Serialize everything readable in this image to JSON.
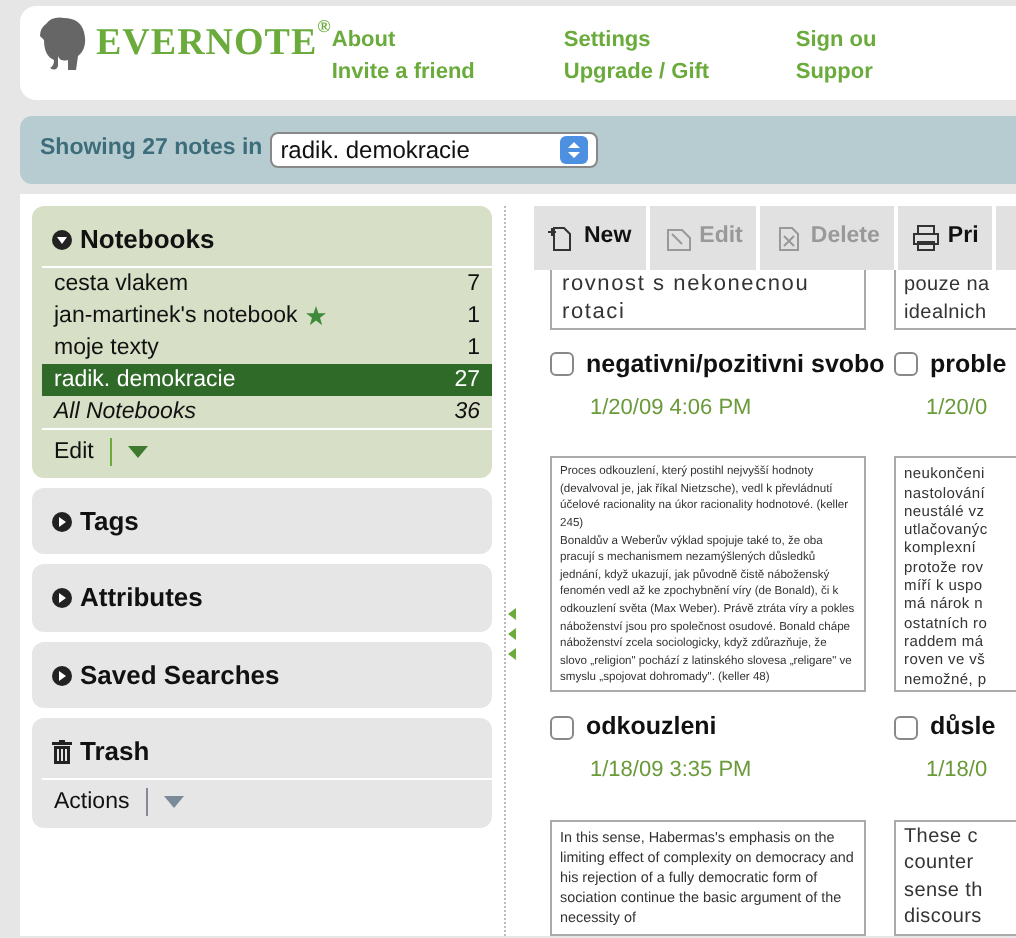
{
  "header": {
    "logo": "EVERNOTE$^{®}$",
    "link_columns": [
      [
        "About",
        "Invite a friend"
      ],
      [
        "Settings",
        "Upgrade / Gift"
      ],
      [
        "Sign ou",
        "Suppor"
      ]
    ]
  },
  "filter_bar": {
    "label": "Showing 27 notes in",
    "notebook_select": "radik. demokracie"
  },
  "sidebar": {
    "sections": [
      {
        "kind": "notebooks",
        "title": "Notebooks",
        "expanded": true,
        "items": [
          {
            "name": "cesta vlakem",
            "count": "7",
            "selected": false,
            "starred": false,
            "italic": false
          },
          {
            "name": "jan-martinek's notebook",
            "count": "1",
            "selected": false,
            "starred": true,
            "italic": false
          },
          {
            "name": "moje texty",
            "count": "1",
            "selected": false,
            "starred": false,
            "italic": false
          },
          {
            "name": "radik. demokracie",
            "count": "27",
            "selected": true,
            "starred": false,
            "italic": false
          },
          {
            "name": "All Notebooks",
            "count": "36",
            "selected": false,
            "starred": false,
            "italic": true
          }
        ],
        "action": "Edit"
      },
      {
        "kind": "collapsible",
        "title": "Tags",
        "expanded": false
      },
      {
        "kind": "collapsible",
        "title": "Attributes",
        "expanded": false
      },
      {
        "kind": "collapsible",
        "title": "Saved Searches",
        "expanded": false
      },
      {
        "kind": "trash",
        "title": "Trash",
        "action": "Actions"
      }
    ]
  },
  "toolbar": [
    {
      "label": "New",
      "disabled": false
    },
    {
      "label": "Edit",
      "disabled": true
    },
    {
      "label": "Delete",
      "disabled": true
    },
    {
      "label": "Pri",
      "disabled": false
    }
  ],
  "notes": [
    {
      "kind": "large",
      "snippet_lines": [
        "rovnost s nekonecnou",
        "rotaci"
      ],
      "title": "negativni/pozitivni svobo",
      "checked": false,
      "date": "1/20/09 4:06 PM"
    },
    {
      "kind": "large",
      "snippet_lines": [
        "pouze na",
        "idealnich"
      ],
      "title": "proble",
      "checked": false,
      "date": "1/20/0"
    },
    {
      "kind": "tiny",
      "snippet": "Proces odkouzlení, který postihl nejvyšší hodnoty (devalvoval je, jak říkal Nietzsche), vedl k převládnutí účelové racionality na úkor racionality hodnotové. (keller 245)\nBonaldův a Weberův výklad spojuje také to, že oba pracují s mechanismem nezamýšlených důsledků jednání, když ukazují, jak původně čistě náboženský fenomén vedl až ke zpochybnění víry (de Bonald), či k odkouzlení světa (Max Weber). Právě ztráta víry a pokles náboženství jsou pro společnost osudové. Bonald chápe náboženství zcela sociologicky, když zdůrazňuje, že slovo „religion\" pochází z latinského slovesa „religare\" ve smyslu „spojovat dohromady\". (keller 48)",
      "title": "odkouzleni",
      "checked": false,
      "date": "1/18/09 3:35 PM"
    },
    {
      "kind": "medium",
      "snippet_lines": [
        "neukončeni",
        "nastolování",
        "neustálé vz",
        "utlačovanýc",
        "komplexní",
        "protože rov",
        "míří k uspo",
        "má nárok n",
        "ostatních ro",
        "raddem má",
        "roven ve vš",
        "nemožné, p"
      ],
      "title": "důsle",
      "checked": false,
      "date": "1/18/0"
    },
    {
      "kind": "small",
      "snippet": "In this sense, Habermas's emphasis on the limiting effect of complexity on democracy and his rejection of a fully democratic form of sociation continue the basic argument of the necessity of"
    },
    {
      "kind": "large",
      "snippet_lines": [
        "These c",
        "counter",
        "sense th",
        "discours"
      ]
    }
  ]
}
